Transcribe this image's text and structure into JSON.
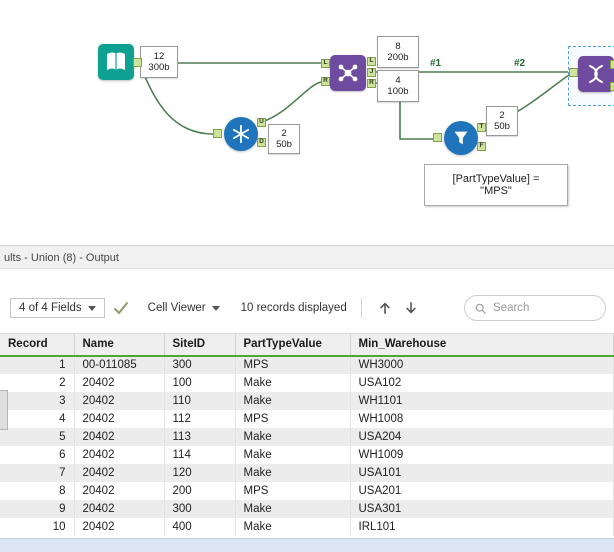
{
  "canvas": {
    "annotations": {
      "input": [
        "12",
        "300b"
      ],
      "join_top": [
        "8",
        "200b"
      ],
      "join_bottom": [
        "4",
        "100b"
      ],
      "unique": [
        "2",
        "50b"
      ],
      "filter": [
        "2",
        "50b"
      ]
    },
    "comment": [
      "[PartTypeValue] =",
      "\"MPS\""
    ],
    "wire_labels": [
      "#1",
      "#2"
    ],
    "anchors": {
      "join_in": [
        "L",
        "R"
      ],
      "join_out": [
        "L",
        "J",
        "R"
      ],
      "unique_out": [
        "U",
        "D"
      ],
      "filter_out": [
        "T",
        "F"
      ]
    },
    "colors": {
      "wire": "#4e7f52",
      "input_tool": "#0EA192",
      "join_tool": "#6E4B9E",
      "union_tool": "#6E4B9E",
      "unique_tool": "#1F74BC",
      "filter_tool": "#1F74BC",
      "header_underline": "#4ea72e",
      "selection_dash": "#5b9bd5"
    }
  },
  "results": {
    "title": "ults - Union (8) - Output",
    "toolbar": {
      "fields_dropdown": "4 of 4 Fields",
      "cell_viewer": "Cell Viewer",
      "records_text": "10 records displayed",
      "search_placeholder": "Search"
    },
    "table": {
      "columns": [
        "Record",
        "Name",
        "SiteID",
        "PartTypeValue",
        "Min_Warehouse"
      ],
      "rows": [
        [
          "1",
          "00-011085",
          "300",
          "MPS",
          "WH3000"
        ],
        [
          "2",
          "20402",
          "100",
          "Make",
          "USA102"
        ],
        [
          "3",
          "20402",
          "110",
          "Make",
          "WH1101"
        ],
        [
          "4",
          "20402",
          "112",
          "MPS",
          "WH1008"
        ],
        [
          "5",
          "20402",
          "113",
          "Make",
          "USA204"
        ],
        [
          "6",
          "20402",
          "114",
          "Make",
          "WH1009"
        ],
        [
          "7",
          "20402",
          "120",
          "Make",
          "USA101"
        ],
        [
          "8",
          "20402",
          "200",
          "MPS",
          "USA201"
        ],
        [
          "9",
          "20402",
          "300",
          "Make",
          "USA301"
        ],
        [
          "10",
          "20402",
          "400",
          "Make",
          "IRL101"
        ]
      ]
    }
  }
}
